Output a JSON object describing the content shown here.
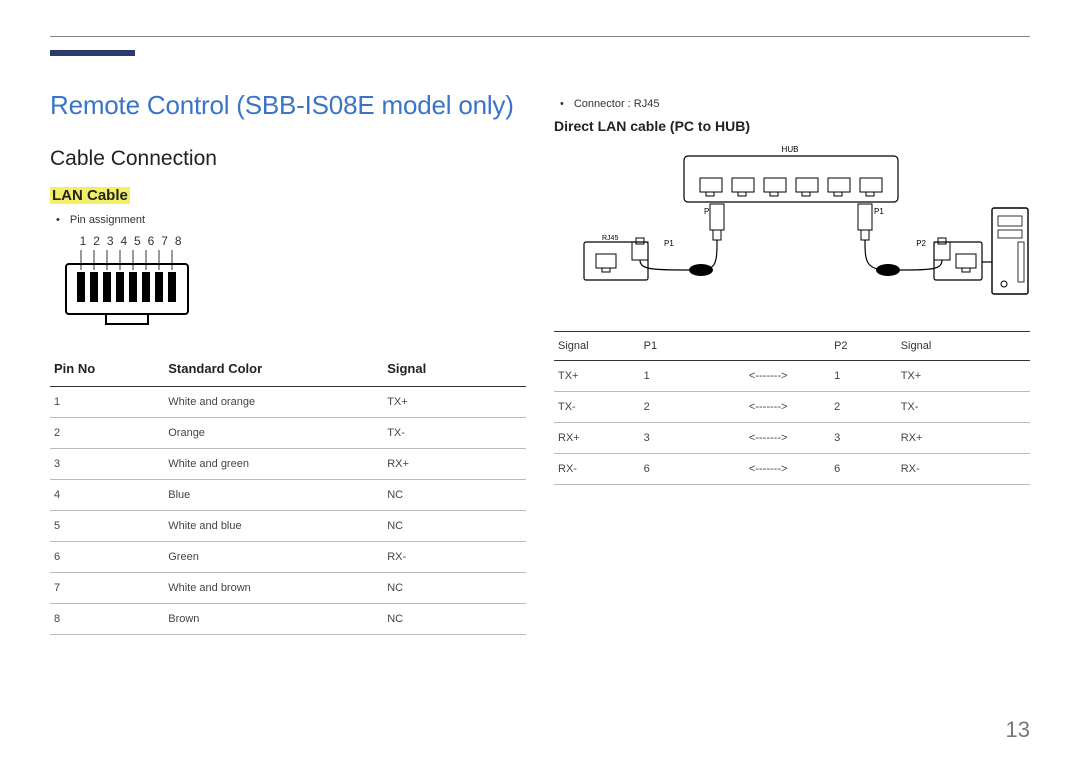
{
  "page_number": "13",
  "title": "Remote Control (SBB-IS08E model only)",
  "section": "Cable Connection",
  "subsection": "LAN Cable",
  "bullets_left": [
    "Pin assignment"
  ],
  "rj45_pins": [
    "1",
    "2",
    "3",
    "4",
    "5",
    "6",
    "7",
    "8"
  ],
  "pin_table": {
    "headers": {
      "pin_no": "Pin No",
      "color": "Standard Color",
      "signal": "Signal"
    },
    "rows": [
      {
        "pin": "1",
        "color": "White and orange",
        "signal": "TX+"
      },
      {
        "pin": "2",
        "color": "Orange",
        "signal": "TX-"
      },
      {
        "pin": "3",
        "color": "White and green",
        "signal": "RX+"
      },
      {
        "pin": "4",
        "color": "Blue",
        "signal": "NC"
      },
      {
        "pin": "5",
        "color": "White and blue",
        "signal": "NC"
      },
      {
        "pin": "6",
        "color": "Green",
        "signal": "RX-"
      },
      {
        "pin": "7",
        "color": "White and brown",
        "signal": "NC"
      },
      {
        "pin": "8",
        "color": "Brown",
        "signal": "NC"
      }
    ]
  },
  "bullets_right": [
    "Connector : RJ45"
  ],
  "right_subhead": "Direct LAN cable (PC to HUB)",
  "diagram_labels": {
    "hub": "HUB",
    "rj45": "RJ45",
    "p1": "P1",
    "p2": "P2"
  },
  "signal_table": {
    "headers": {
      "sig_l": "Signal",
      "p1": "P1",
      "p2": "P2",
      "sig_r": "Signal"
    },
    "arrow": "<------->",
    "rows": [
      {
        "sl": "TX+",
        "p1": "1",
        "p2": "1",
        "sr": "TX+"
      },
      {
        "sl": "TX-",
        "p1": "2",
        "p2": "2",
        "sr": "TX-"
      },
      {
        "sl": "RX+",
        "p1": "3",
        "p2": "3",
        "sr": "RX+"
      },
      {
        "sl": "RX-",
        "p1": "6",
        "p2": "6",
        "sr": "RX-"
      }
    ]
  }
}
